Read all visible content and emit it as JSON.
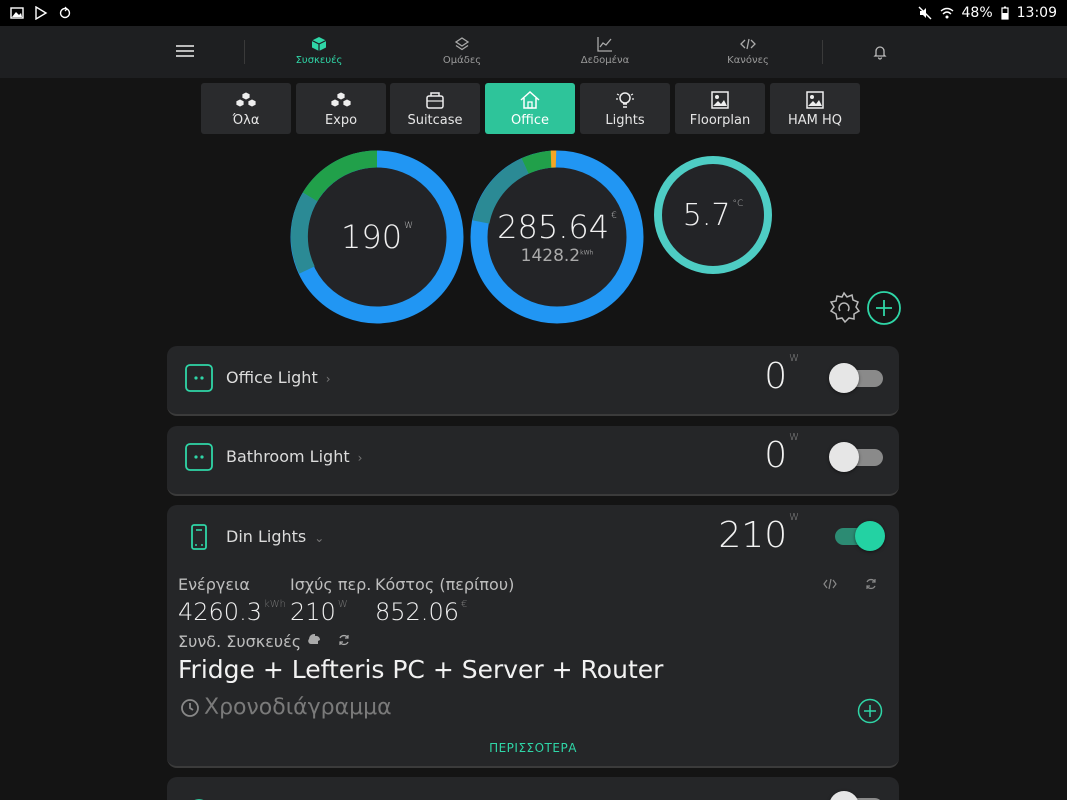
{
  "status_bar": {
    "battery": "48%",
    "time": "13:09"
  },
  "nav": {
    "tabs": [
      {
        "label": "Συσκευές",
        "active": true
      },
      {
        "label": "Ομάδες"
      },
      {
        "label": "Δεδομένα"
      },
      {
        "label": "Κανόνες"
      }
    ]
  },
  "groups": [
    {
      "label": "Όλα",
      "icon": "cubes-icon"
    },
    {
      "label": "Expo",
      "icon": "cubes-icon"
    },
    {
      "label": "Suitcase",
      "icon": "suitcase-icon"
    },
    {
      "label": "Office",
      "icon": "home-icon",
      "active": true
    },
    {
      "label": "Lights",
      "icon": "bulb-icon"
    },
    {
      "label": "Floorplan",
      "icon": "image-icon"
    },
    {
      "label": "HAM HQ",
      "icon": "image-icon"
    }
  ],
  "gauges": {
    "power": {
      "value": "190",
      "unit": "W"
    },
    "cost": {
      "value": "285.64",
      "unit": "€",
      "energy": "1428.2",
      "energy_unit": "kWh"
    },
    "temperature": {
      "value": "5.7",
      "unit": "°C"
    }
  },
  "devices": [
    {
      "name": "Office Light",
      "power": "0",
      "unit": "W",
      "on": false
    },
    {
      "name": "Bathroom Light",
      "power": "0",
      "unit": "W",
      "on": false
    },
    {
      "name": "Din Lights",
      "power": "210",
      "unit": "W",
      "on": true,
      "stats": {
        "energy_label": "Ενέργεια",
        "energy_value": "4260.3",
        "energy_unit": "kWh",
        "avg_power_label": "Ισχύς περ.",
        "avg_power_value": "210",
        "avg_power_unit": "W",
        "cost_label": "Κόστος (περίπου)",
        "cost_value": "852.06",
        "cost_unit": "€"
      },
      "linked_label": "Συνδ. Συσκευές",
      "linked_devices": "Fridge + Lefteris PC + Server + Router",
      "schedule_label": "Χρονοδιάγραμμα",
      "more_label": "ΠΕΡΙΣΣΟΤΕΡΑ"
    }
  ],
  "colors": {
    "accent": "#2fd6a7",
    "blue": "#2196f3",
    "green": "#21a04a",
    "teal": "#2b8a95",
    "temp": "#4ecdc4"
  }
}
